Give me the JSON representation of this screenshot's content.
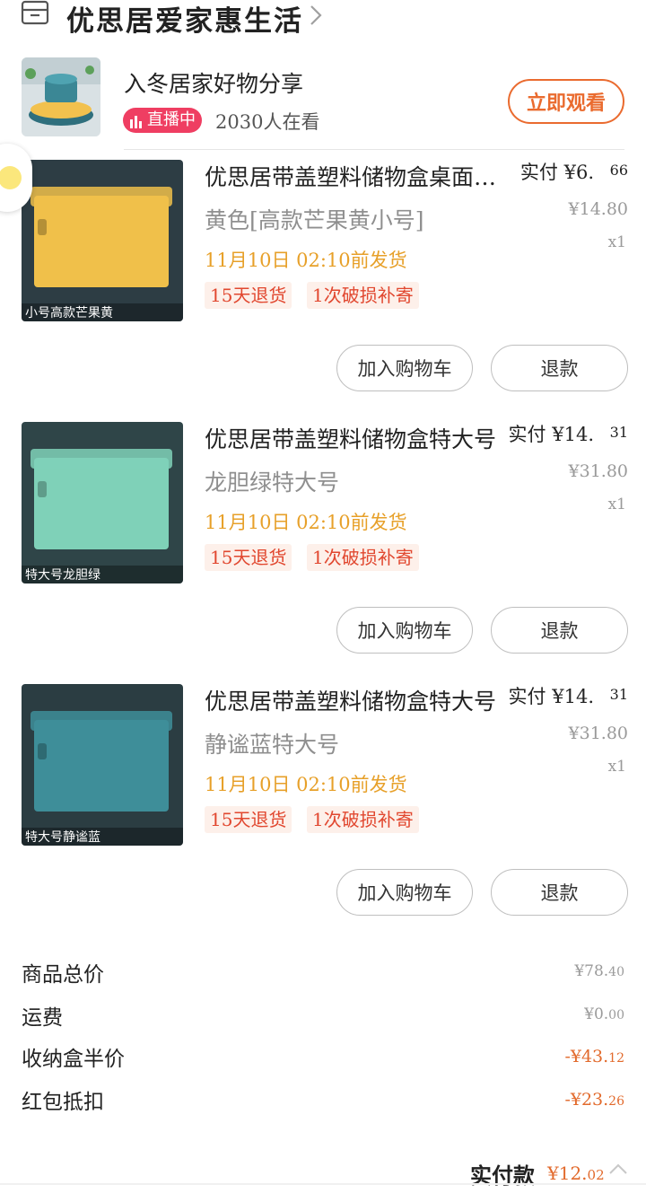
{
  "shop": {
    "name": "优思居爱家惠生活",
    "icon": "store-icon",
    "arrow": "chevron-right-icon"
  },
  "live": {
    "title": "入冬居家好物分享",
    "badge": "直播中",
    "viewers": "2030人在看",
    "button": "立即观看"
  },
  "items": [
    {
      "name": "优思居带盖塑料储物盒桌面收纳盒",
      "spec": "黄色[高款芒果黄小号]",
      "ship": "11月10日 02:10前发货",
      "tag1": "15天退货",
      "tag2": "1次破损补寄",
      "paid_label": "实付",
      "paid_int": "¥6.",
      "paid_dec": "66",
      "orig": "¥14.80",
      "qty": "x1",
      "cart_button": "加入购物车",
      "refund_button": "退款",
      "image_caption": "小号高款芒果黄",
      "image_color": "#f0c04a",
      "image_bg": "#2d3d44"
    },
    {
      "name": "优思居带盖塑料储物盒特大号",
      "spec": "龙胆绿特大号",
      "ship": "11月10日 02:10前发货",
      "tag1": "15天退货",
      "tag2": "1次破损补寄",
      "paid_label": "实付",
      "paid_int": "¥14.",
      "paid_dec": "31",
      "orig": "¥31.80",
      "qty": "x1",
      "cart_button": "加入购物车",
      "refund_button": "退款",
      "image_caption": "特大号龙胆绿",
      "image_color": "#7fd1b8",
      "image_bg": "#2f4548"
    },
    {
      "name": "优思居带盖塑料储物盒特大号",
      "spec": "静谧蓝特大号",
      "ship": "11月10日 02:10前发货",
      "tag1": "15天退货",
      "tag2": "1次破损补寄",
      "paid_label": "实付",
      "paid_int": "¥14.",
      "paid_dec": "31",
      "orig": "¥31.80",
      "qty": "x1",
      "cart_button": "加入购物车",
      "refund_button": "退款",
      "image_caption": "特大号静谧蓝",
      "image_color": "#3e8e99",
      "image_bg": "#2b3d42"
    }
  ],
  "summary": {
    "rows": [
      {
        "label": "商品总价",
        "val_int": "¥78.",
        "val_dec": "40",
        "style": "grey"
      },
      {
        "label": "运费",
        "val_int": "¥0.",
        "val_dec": "00",
        "style": "grey"
      },
      {
        "label": "收纳盒半价",
        "val_int": "-¥43.",
        "val_dec": "12",
        "style": "orange"
      },
      {
        "label": "红包抵扣",
        "val_int": "-¥23.",
        "val_dec": "26",
        "style": "orange"
      }
    ],
    "total_label": "实付款",
    "total_int": "¥12.",
    "total_dec": "02"
  }
}
